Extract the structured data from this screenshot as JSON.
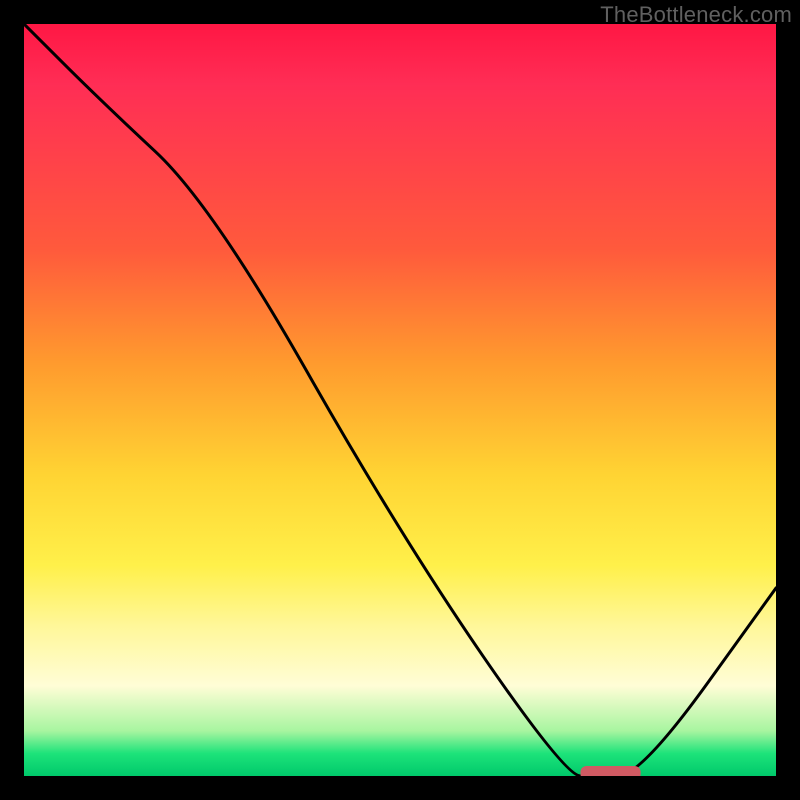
{
  "watermark": "TheBottleneck.com",
  "chart_data": {
    "type": "line",
    "title": "",
    "xlabel": "",
    "ylabel": "",
    "xlim": [
      0,
      100
    ],
    "ylim": [
      0,
      100
    ],
    "grid": false,
    "legend": false,
    "x": [
      0,
      10,
      25,
      50,
      72,
      76,
      82,
      100
    ],
    "values": [
      100,
      90,
      76,
      32,
      0,
      0,
      0,
      25
    ],
    "marker": {
      "x_start": 74,
      "x_end": 82,
      "y": 0,
      "color": "#d05a63"
    },
    "background_gradient_stops": [
      {
        "pos": 0,
        "color": "#ff1744"
      },
      {
        "pos": 30,
        "color": "#ff5a3c"
      },
      {
        "pos": 60,
        "color": "#ffd433"
      },
      {
        "pos": 88,
        "color": "#fffdd6"
      },
      {
        "pos": 100,
        "color": "#00c96b"
      }
    ]
  }
}
